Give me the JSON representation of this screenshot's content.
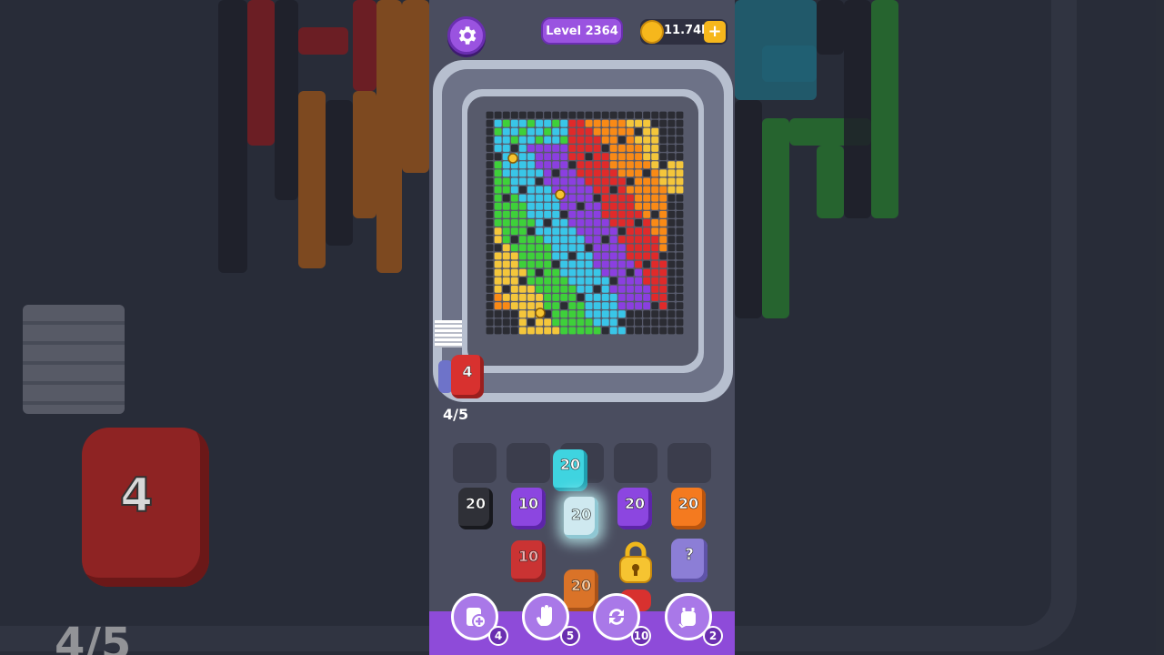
{
  "header": {
    "level_label": "Level 2364",
    "coins_label": "11.74k",
    "coin_plus_label": "+"
  },
  "queue": {
    "runner_count": "4",
    "progress_label": "4/5",
    "progress": 0.8
  },
  "mirror": {
    "left_cup_label": "4",
    "left_fraction": "4/5"
  },
  "shelf": {
    "top_row": [
      {
        "id": "slot-1",
        "cup": null
      },
      {
        "id": "slot-2",
        "cup": null
      },
      {
        "id": "slot-3",
        "cup": {
          "color": "#3fd4e0",
          "count": "20"
        }
      },
      {
        "id": "slot-4",
        "cup": null
      },
      {
        "id": "slot-5",
        "cup": null
      }
    ],
    "cups": [
      {
        "name": "cup-black-20",
        "color": "#2f3037",
        "count": "20"
      },
      {
        "name": "cup-purple-10",
        "color": "#8c46e0",
        "count": "10"
      },
      {
        "name": "cup-white-20",
        "color": "#cfe9f0",
        "count": "20"
      },
      {
        "name": "cup-purple-20",
        "color": "#8c46e0",
        "count": "20"
      },
      {
        "name": "cup-orange-20",
        "color": "#f47a1f",
        "count": "20"
      },
      {
        "name": "cup-red-10",
        "color": "#d8312f",
        "count": "10"
      },
      {
        "name": "cup-orange-20-lower",
        "color": "#f47a1f",
        "count": "20"
      }
    ],
    "mystery_label": "?"
  },
  "tools": [
    {
      "name": "add-slot-tool",
      "icon": "add-cup-icon",
      "count": "4"
    },
    {
      "name": "hand-tool",
      "icon": "hand-icon",
      "count": "5"
    },
    {
      "name": "shuffle-tool",
      "icon": "shuffle-icon",
      "count": "10"
    },
    {
      "name": "magic-tool",
      "icon": "magic-cup-icon",
      "count": "2"
    }
  ],
  "colors": {
    "accent_purple": "#9a53e0",
    "maze_colors": [
      "#2b2c33",
      "#39c6e8",
      "#8b3fe0",
      "#e02a2a",
      "#f98a16",
      "#f4c63b",
      "#3ed03a"
    ]
  }
}
